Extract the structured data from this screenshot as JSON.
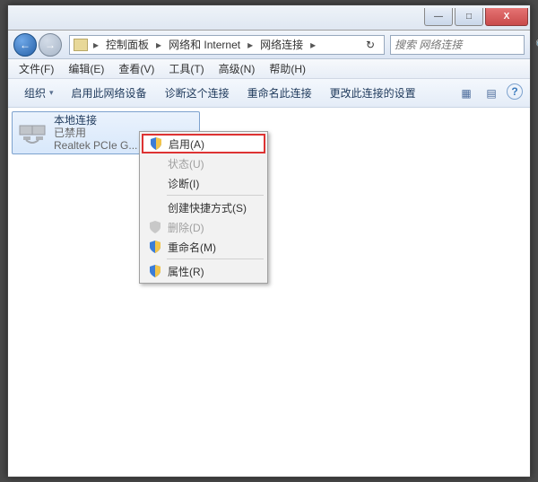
{
  "titlebar": {
    "min": "—",
    "max": "□",
    "close": "X"
  },
  "nav": {
    "back": "←",
    "fwd": "→"
  },
  "breadcrumb": {
    "segs": [
      "控制面板",
      "网络和 Internet",
      "网络连接"
    ],
    "arrow": "▸",
    "refresh": "↻"
  },
  "search": {
    "placeholder": "搜索 网络连接",
    "icon": "🔍"
  },
  "menubar": {
    "items": [
      "文件(F)",
      "编辑(E)",
      "查看(V)",
      "工具(T)",
      "高级(N)",
      "帮助(H)"
    ]
  },
  "toolbar": {
    "organize": "组织",
    "enable": "启用此网络设备",
    "diagnose": "诊断这个连接",
    "rename": "重命名此连接",
    "change": "更改此连接的设置",
    "view": "▦",
    "pane": "▤",
    "help": "?"
  },
  "connection": {
    "name": "本地连接",
    "status": "已禁用",
    "adapter": "Realtek PCIe G..."
  },
  "ctxmenu": {
    "enable": "启用(A)",
    "status": "状态(U)",
    "diagnose": "诊断(I)",
    "shortcut": "创建快捷方式(S)",
    "delete": "删除(D)",
    "rename": "重命名(M)",
    "props": "属性(R)"
  }
}
